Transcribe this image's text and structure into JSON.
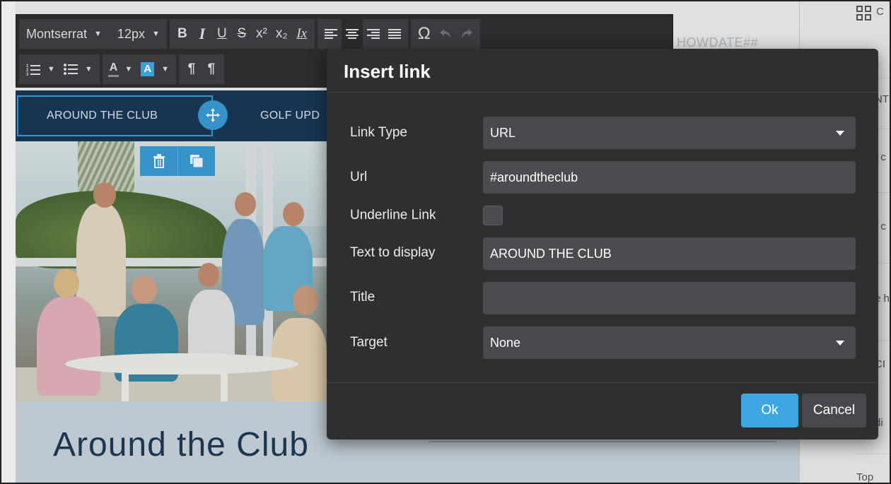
{
  "background_email": {
    "merge_tag": "HOWDATE##",
    "nav_items": [
      {
        "label": "AROUND THE CLUB"
      },
      {
        "label": "GOLF UPD"
      }
    ],
    "heading": "Around the Club"
  },
  "right_panel": {
    "fragments": [
      "NT",
      "t c",
      "t c",
      "e h",
      "CI",
      "di"
    ],
    "top_label": "Top"
  },
  "toolbar": {
    "font_family": "Montserrat",
    "font_size": "12px",
    "bold_label": "B",
    "italic_label": "I",
    "underline_label": "U",
    "strike_label": "S",
    "superscript_label": "x²",
    "subscript_label": "x₂",
    "clear_format_label": "Ix",
    "special_char_label": "Ω",
    "text_color_label": "A",
    "highlight_color_label": "A",
    "highlight_color": "#3aa0dc",
    "ltr_label": "¶",
    "rtl_label": "¶"
  },
  "modal": {
    "title": "Insert link",
    "fields": {
      "link_type": {
        "label": "Link Type",
        "value": "URL"
      },
      "url": {
        "label": "Url",
        "value": "#aroundtheclub"
      },
      "underline": {
        "label": "Underline Link",
        "checked": false
      },
      "text_to_display": {
        "label": "Text to display",
        "value": "AROUND THE CLUB"
      },
      "title": {
        "label": "Title",
        "value": ""
      },
      "target": {
        "label": "Target",
        "value": "None"
      }
    },
    "ok_label": "Ok",
    "cancel_label": "Cancel"
  },
  "colors": {
    "accent": "#3ca7e0",
    "modal_bg": "#2d2f31",
    "toolbar_bg": "#2a2c2e",
    "nav_bg": "#1a3a5a"
  }
}
